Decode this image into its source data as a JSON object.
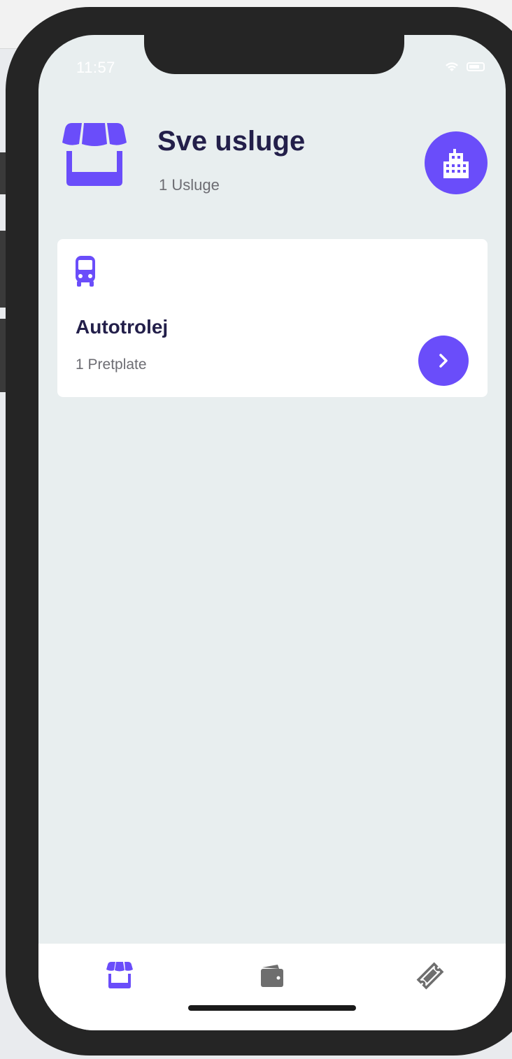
{
  "status_bar": {
    "time": "11:57"
  },
  "header": {
    "title": "Sve usluge",
    "subtitle": "1 Usluge"
  },
  "services": [
    {
      "name": "Autotrolej",
      "count_label": "1 Pretplate",
      "icon": "bus-icon"
    }
  ],
  "tab_bar": {
    "tabs": [
      {
        "icon": "store-icon",
        "active": true
      },
      {
        "icon": "wallet-icon",
        "active": false
      },
      {
        "icon": "ticket-icon",
        "active": false
      }
    ]
  },
  "colors": {
    "accent": "#6a4dfa",
    "title": "#231f4a",
    "muted": "#6d6d73",
    "screen_bg": "#e8eeef",
    "inactive_icon": "#6e6e6e"
  }
}
